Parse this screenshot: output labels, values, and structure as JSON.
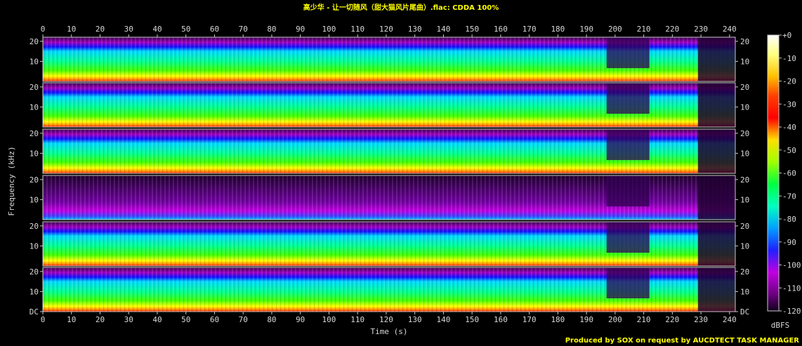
{
  "title": "高少华 - 让一切随风（甜大猫风片尾曲）.flac: CDDA 100%",
  "footer": "Produced by SOX on request by AUCDTECT TASK MANAGER",
  "chart_data": {
    "type": "heatmap",
    "title": "高少华 - 让一切随风（甜大猫风片尾曲）.flac: CDDA 100%",
    "xlabel": "Time (s)",
    "ylabel": "Frequency (kHz)",
    "x_ticks": [
      0,
      10,
      20,
      30,
      40,
      50,
      60,
      70,
      80,
      90,
      100,
      110,
      120,
      130,
      140,
      150,
      160,
      170,
      180,
      190,
      200,
      210,
      220,
      230,
      240
    ],
    "xlim": [
      0,
      242
    ],
    "y_ticks": [
      [
        "20",
        "10"
      ],
      [
        "20",
        "10"
      ],
      [
        "20",
        "10"
      ],
      [
        "20",
        "10"
      ],
      [
        "20",
        "10"
      ],
      [
        "20",
        "10",
        "DC"
      ]
    ],
    "ylim": [
      0,
      22.05
    ],
    "panels": 6,
    "colorbar": {
      "label": "dBFS",
      "ticks": [
        "+0",
        "-10",
        "-20",
        "-30",
        "-40",
        "-50",
        "-60",
        "-70",
        "-80",
        "-90",
        "-100",
        "-110",
        "-120"
      ],
      "range": [
        -120,
        0
      ]
    },
    "colors": {
      "background": "#000000",
      "title": "#ffff00",
      "axis": "#cfcfcf"
    }
  }
}
